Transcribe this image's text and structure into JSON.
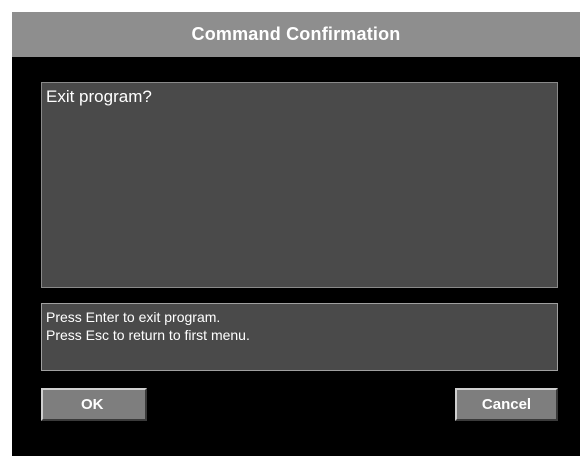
{
  "dialog": {
    "title": "Command Confirmation",
    "message": "Exit program?",
    "hints": [
      "Press Enter to exit program.",
      "Press Esc to return to first menu."
    ],
    "ok_label": "OK",
    "cancel_label": "Cancel"
  },
  "colors": {
    "title_bar": "#8e8e8e",
    "background": "#000000",
    "panel": "#4a4a4a",
    "button": "#7e7e7e",
    "text": "#ffffff"
  }
}
